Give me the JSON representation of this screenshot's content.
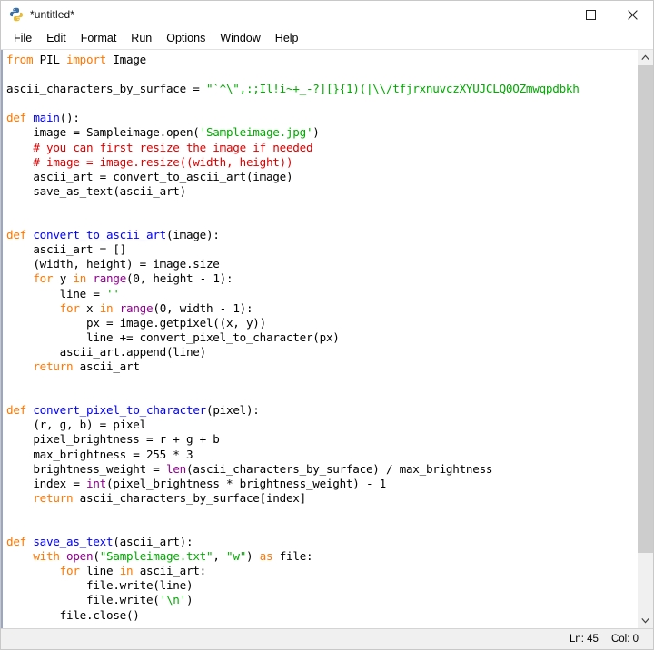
{
  "window": {
    "title": "*untitled*",
    "icon": "python-idle-icon",
    "controls": {
      "minimize": "—",
      "maximize": "☐",
      "close": "✕"
    }
  },
  "menubar": {
    "items": [
      {
        "label": "File"
      },
      {
        "label": "Edit"
      },
      {
        "label": "Format"
      },
      {
        "label": "Run"
      },
      {
        "label": "Options"
      },
      {
        "label": "Window"
      },
      {
        "label": "Help"
      }
    ]
  },
  "editor": {
    "lines": [
      [
        {
          "t": "from ",
          "c": "kw"
        },
        {
          "t": "PIL ",
          "c": "pl"
        },
        {
          "t": "import ",
          "c": "kw"
        },
        {
          "t": "Image",
          "c": "pl"
        }
      ],
      [],
      [
        {
          "t": "ascii_characters_by_surface = ",
          "c": "pl"
        },
        {
          "t": "\"`^\\\",:;Il!i~+_-?][}{1)(|\\\\/tfjrxnuvczXYUJCLQ0OZmwqpdbkh",
          "c": "str"
        }
      ],
      [],
      [
        {
          "t": "def ",
          "c": "kw"
        },
        {
          "t": "main",
          "c": "fn"
        },
        {
          "t": "():",
          "c": "pl"
        }
      ],
      [
        {
          "t": "    image = Sampleimage.open(",
          "c": "pl"
        },
        {
          "t": "'Sampleimage.jpg'",
          "c": "str"
        },
        {
          "t": ")",
          "c": "pl"
        }
      ],
      [
        {
          "t": "    # you can first resize the image if needed",
          "c": "com"
        }
      ],
      [
        {
          "t": "    # image = image.resize((width, height))",
          "c": "com"
        }
      ],
      [
        {
          "t": "    ascii_art = convert_to_ascii_art(image)",
          "c": "pl"
        }
      ],
      [
        {
          "t": "    save_as_text(ascii_art)",
          "c": "pl"
        }
      ],
      [],
      [],
      [
        {
          "t": "def ",
          "c": "kw"
        },
        {
          "t": "convert_to_ascii_art",
          "c": "fn"
        },
        {
          "t": "(image):",
          "c": "pl"
        }
      ],
      [
        {
          "t": "    ascii_art = []",
          "c": "pl"
        }
      ],
      [
        {
          "t": "    (width, height) = image.size",
          "c": "pl"
        }
      ],
      [
        {
          "t": "    ",
          "c": "pl"
        },
        {
          "t": "for ",
          "c": "kw"
        },
        {
          "t": "y ",
          "c": "pl"
        },
        {
          "t": "in ",
          "c": "kw"
        },
        {
          "t": "range",
          "c": "bi"
        },
        {
          "t": "(0, height - 1):",
          "c": "pl"
        }
      ],
      [
        {
          "t": "        line = ",
          "c": "pl"
        },
        {
          "t": "''",
          "c": "str"
        }
      ],
      [
        {
          "t": "        ",
          "c": "pl"
        },
        {
          "t": "for ",
          "c": "kw"
        },
        {
          "t": "x ",
          "c": "pl"
        },
        {
          "t": "in ",
          "c": "kw"
        },
        {
          "t": "range",
          "c": "bi"
        },
        {
          "t": "(0, width - 1):",
          "c": "pl"
        }
      ],
      [
        {
          "t": "            px = image.getpixel((x, y))",
          "c": "pl"
        }
      ],
      [
        {
          "t": "            line += convert_pixel_to_character(px)",
          "c": "pl"
        }
      ],
      [
        {
          "t": "        ascii_art.append(line)",
          "c": "pl"
        }
      ],
      [
        {
          "t": "    ",
          "c": "pl"
        },
        {
          "t": "return ",
          "c": "kw"
        },
        {
          "t": "ascii_art",
          "c": "pl"
        }
      ],
      [],
      [],
      [
        {
          "t": "def ",
          "c": "kw"
        },
        {
          "t": "convert_pixel_to_character",
          "c": "fn"
        },
        {
          "t": "(pixel):",
          "c": "pl"
        }
      ],
      [
        {
          "t": "    (r, g, b) = pixel",
          "c": "pl"
        }
      ],
      [
        {
          "t": "    pixel_brightness = r + g + b",
          "c": "pl"
        }
      ],
      [
        {
          "t": "    max_brightness = 255 * 3",
          "c": "pl"
        }
      ],
      [
        {
          "t": "    brightness_weight = ",
          "c": "pl"
        },
        {
          "t": "len",
          "c": "bi"
        },
        {
          "t": "(ascii_characters_by_surface) / max_brightness",
          "c": "pl"
        }
      ],
      [
        {
          "t": "    index = ",
          "c": "pl"
        },
        {
          "t": "int",
          "c": "bi"
        },
        {
          "t": "(pixel_brightness * brightness_weight) - 1",
          "c": "pl"
        }
      ],
      [
        {
          "t": "    ",
          "c": "pl"
        },
        {
          "t": "return ",
          "c": "kw"
        },
        {
          "t": "ascii_characters_by_surface[index]",
          "c": "pl"
        }
      ],
      [],
      [],
      [
        {
          "t": "def ",
          "c": "kw"
        },
        {
          "t": "save_as_text",
          "c": "fn"
        },
        {
          "t": "(ascii_art):",
          "c": "pl"
        }
      ],
      [
        {
          "t": "    ",
          "c": "pl"
        },
        {
          "t": "with ",
          "c": "kw"
        },
        {
          "t": "open",
          "c": "bi"
        },
        {
          "t": "(",
          "c": "pl"
        },
        {
          "t": "\"Sampleimage.txt\"",
          "c": "str"
        },
        {
          "t": ", ",
          "c": "pl"
        },
        {
          "t": "\"w\"",
          "c": "str"
        },
        {
          "t": ") ",
          "c": "pl"
        },
        {
          "t": "as ",
          "c": "kw"
        },
        {
          "t": "file:",
          "c": "pl"
        }
      ],
      [
        {
          "t": "        ",
          "c": "pl"
        },
        {
          "t": "for ",
          "c": "kw"
        },
        {
          "t": "line ",
          "c": "pl"
        },
        {
          "t": "in ",
          "c": "kw"
        },
        {
          "t": "ascii_art:",
          "c": "pl"
        }
      ],
      [
        {
          "t": "            file.write(line)",
          "c": "pl"
        }
      ],
      [
        {
          "t": "            file.write(",
          "c": "pl"
        },
        {
          "t": "'\\n'",
          "c": "str"
        },
        {
          "t": ")",
          "c": "pl"
        }
      ],
      [
        {
          "t": "        file.close()",
          "c": "pl"
        }
      ]
    ]
  },
  "scrollbar": {
    "up_arrow": "⌃",
    "down_arrow": "⌄"
  },
  "statusbar": {
    "line_label": "Ln: 45",
    "col_label": "Col: 0"
  },
  "colors": {
    "keyword": "#ff7700",
    "string": "#00aa00",
    "comment": "#dd0000",
    "definition": "#0000ff",
    "builtin": "#900090",
    "plain": "#000000",
    "background": "#ffffff",
    "statusbar_bg": "#f0f0f0",
    "scrollbar_thumb": "#cdcdcd"
  }
}
